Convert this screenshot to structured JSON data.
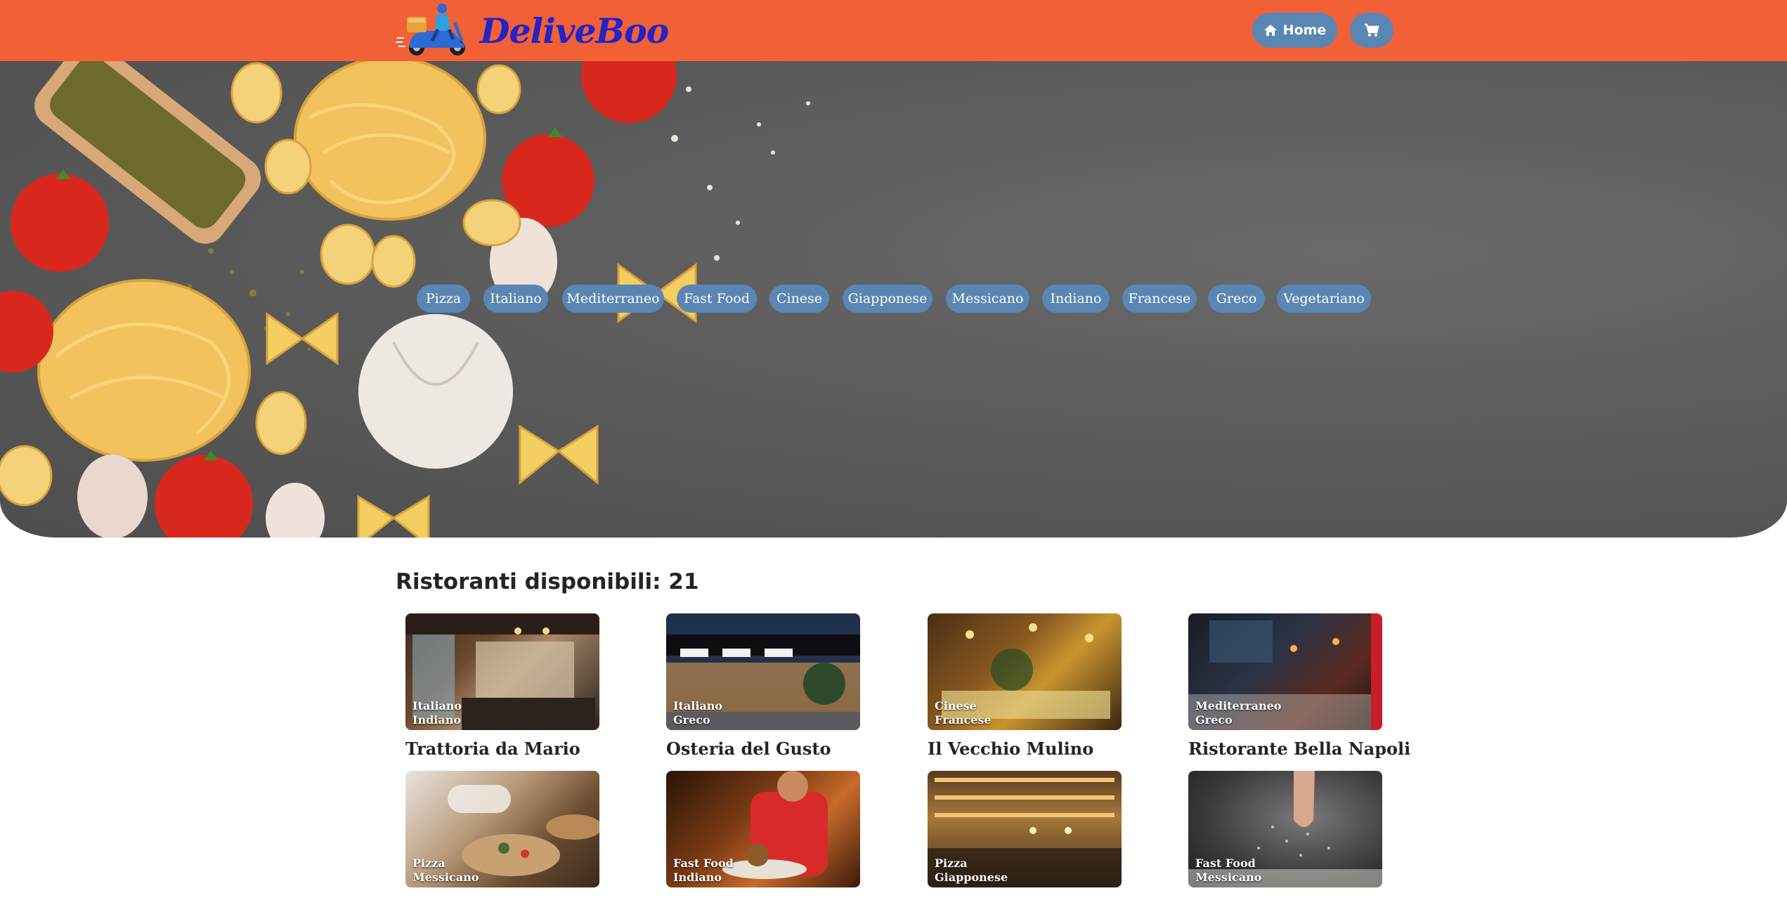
{
  "brand": {
    "name": "DeliveBoo",
    "logo_icon": "delivery-scooter-icon"
  },
  "nav": {
    "home_label": "Home",
    "home_icon": "home-icon",
    "cart_icon": "cart-icon"
  },
  "colors": {
    "header": "#f26036",
    "accent": "#5a86b4",
    "brand_text": "#2323c8"
  },
  "categories": [
    "Pizza",
    "Italiano",
    "Mediterraneo",
    "Fast Food",
    "Cinese",
    "Giapponese",
    "Messicano",
    "Indiano",
    "Francese",
    "Greco",
    "Vegetariano"
  ],
  "restaurants": {
    "count_label": "Ristoranti disponibili: 21",
    "items": [
      {
        "name": "Trattoria da Mario",
        "types": [
          "Italiano",
          "Indiano"
        ]
      },
      {
        "name": "Osteria del Gusto",
        "types": [
          "Italiano",
          "Greco"
        ]
      },
      {
        "name": "Il Vecchio Mulino",
        "types": [
          "Cinese",
          "Francese"
        ]
      },
      {
        "name": "Ristorante Bella Napoli",
        "types": [
          "Mediterraneo",
          "Greco"
        ]
      },
      {
        "name": "",
        "types": [
          "Pizza",
          "Messicano"
        ]
      },
      {
        "name": "",
        "types": [
          "Fast Food",
          "Indiano"
        ]
      },
      {
        "name": "",
        "types": [
          "Pizza",
          "Giapponese"
        ]
      },
      {
        "name": "",
        "types": [
          "Fast Food",
          "Messicano"
        ]
      }
    ]
  }
}
